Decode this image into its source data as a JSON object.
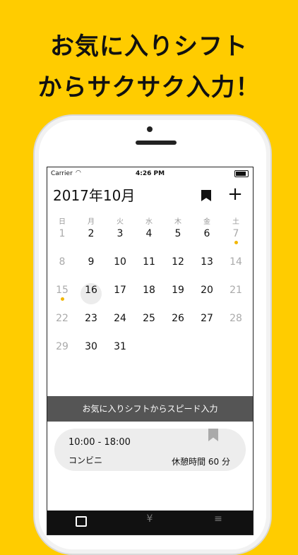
{
  "promo": {
    "line1": "お気に入りシフト",
    "line2": "からサクサク入力！"
  },
  "statusbar": {
    "carrier": "Carrier",
    "time": "4:26 PM"
  },
  "calendar": {
    "month_title": "2017年10月",
    "weekdays": [
      "日",
      "月",
      "火",
      "水",
      "木",
      "金",
      "土"
    ],
    "weeks": [
      [
        "1",
        "2",
        "3",
        "4",
        "5",
        "6",
        "7"
      ],
      [
        "8",
        "9",
        "10",
        "11",
        "12",
        "13",
        "14"
      ],
      [
        "15",
        "16",
        "17",
        "18",
        "19",
        "20",
        "21"
      ],
      [
        "22",
        "23",
        "24",
        "25",
        "26",
        "27",
        "28"
      ],
      [
        "29",
        "30",
        "31",
        "",
        "",
        "",
        ""
      ]
    ],
    "today": "16",
    "marked_days": [
      "7",
      "15"
    ]
  },
  "favorites_banner": "お気に入りシフトからスピード入力",
  "favorite_shift": {
    "time_range": "10:00 - 18:00",
    "place": "コンビニ",
    "break": "休憩時間 60 分"
  },
  "tabbar": {
    "tabs": [
      {
        "icon": "calendar-icon"
      },
      {
        "icon": "yen-icon",
        "label": "¥"
      },
      {
        "icon": "menu-icon",
        "label": "≡"
      }
    ]
  },
  "colors": {
    "background": "#FFCC00",
    "dot": "#F2B705",
    "banner": "#555555",
    "tabbar": "#111111"
  }
}
